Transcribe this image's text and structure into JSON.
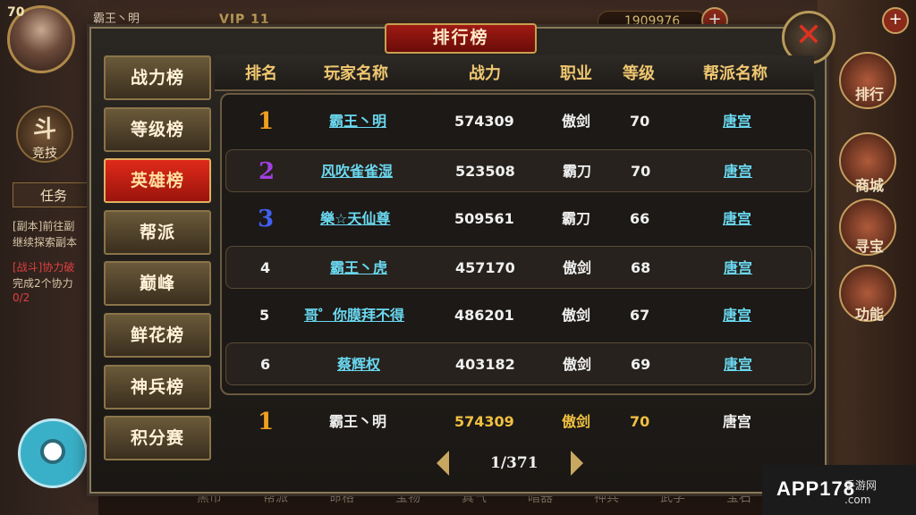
{
  "hud": {
    "level": "70",
    "player_name": "霸王丶明",
    "vip": "VIP 11",
    "gold": "1909976",
    "left_icon_label": "竞技",
    "task_label": "任务",
    "task_lines": [
      "[副本]前往副",
      "继续探索副本",
      "[战斗]协力破",
      "完成2个协力",
      "0/2"
    ],
    "right_icons": [
      "排行",
      "商城",
      "寻宝",
      "功能"
    ],
    "bottom_tabs": [
      "黑市",
      "帮派",
      "命格",
      "宝物",
      "真气",
      "暗器",
      "神兵",
      "武学",
      "宝石"
    ]
  },
  "panel": {
    "title": "排行榜",
    "close": "✕"
  },
  "side_tabs": [
    {
      "label": "战力榜",
      "active": false
    },
    {
      "label": "等级榜",
      "active": false
    },
    {
      "label": "英雄榜",
      "active": true
    },
    {
      "label": "帮派",
      "active": false
    },
    {
      "label": "巅峰",
      "active": false
    },
    {
      "label": "鲜花榜",
      "active": false
    },
    {
      "label": "神兵榜",
      "active": false
    },
    {
      "label": "积分赛",
      "active": false
    }
  ],
  "table": {
    "headers": [
      "排名",
      "玩家名称",
      "战力",
      "职业",
      "等级",
      "帮派名称"
    ],
    "rows": [
      {
        "rank": "1",
        "name": "霸王丶明",
        "power": "574309",
        "job": "傲剑",
        "level": "70",
        "guild": "唐宫",
        "rank_color": "#f0a020"
      },
      {
        "rank": "2",
        "name": "风吹雀雀湿",
        "power": "523508",
        "job": "霸刀",
        "level": "70",
        "guild": "唐宫",
        "rank_color": "#a040e0"
      },
      {
        "rank": "3",
        "name": "樂☆天仙尊",
        "power": "509561",
        "job": "霸刀",
        "level": "66",
        "guild": "唐宫",
        "rank_color": "#4060f0"
      },
      {
        "rank": "4",
        "name": "霸王丶虎",
        "power": "457170",
        "job": "傲剑",
        "level": "68",
        "guild": "唐宫",
        "rank_color": "#f0f0f0"
      },
      {
        "rank": "5",
        "name": "哥゜你膜拜不得",
        "power": "486201",
        "job": "傲剑",
        "level": "67",
        "guild": "唐宫",
        "rank_color": "#f0f0f0"
      },
      {
        "rank": "6",
        "name": "蔡辉权",
        "power": "403182",
        "job": "傲剑",
        "level": "69",
        "guild": "唐宫",
        "rank_color": "#f0f0f0"
      }
    ]
  },
  "self_row": {
    "rank": "1",
    "name": "霸王丶明",
    "power": "574309",
    "job": "傲剑",
    "level": "70",
    "guild": "唐宫"
  },
  "pager": {
    "text": "1/371"
  },
  "watermark": {
    "text": "APP178",
    "sub": "手游网",
    "domain": ".com"
  }
}
